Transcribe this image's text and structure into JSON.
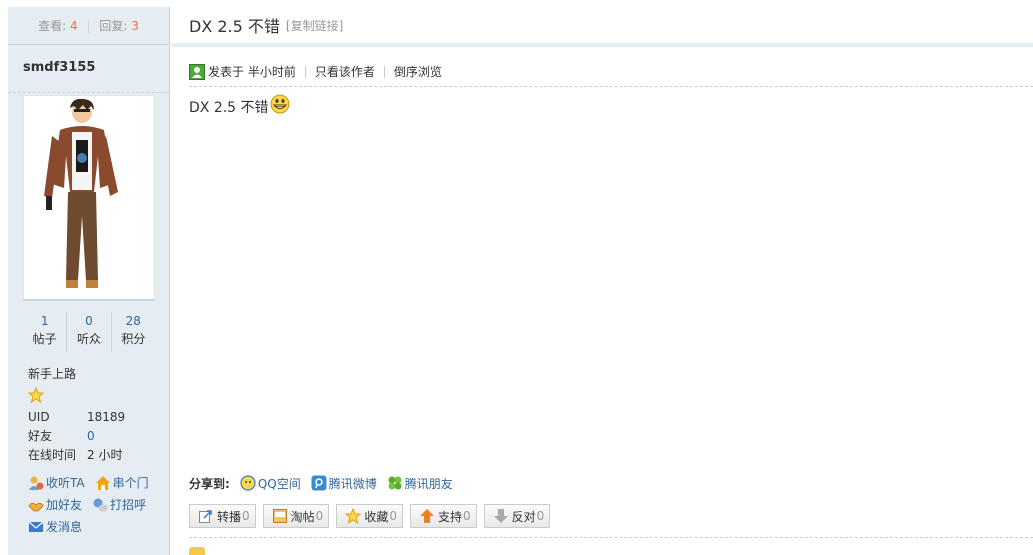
{
  "sidebar": {
    "stats": {
      "views_label": "查看:",
      "views": "4",
      "replies_label": "回复:",
      "replies": "3"
    },
    "author": "smdf3155",
    "counters": [
      {
        "value": "1",
        "label": "帖子"
      },
      {
        "value": "0",
        "label": "听众"
      },
      {
        "value": "28",
        "label": "积分"
      }
    ],
    "rank": "新手上路",
    "info": [
      {
        "key": "UID",
        "value": "18189"
      },
      {
        "key": "好友",
        "value": "0"
      },
      {
        "key": "在线时间",
        "value": "2 小时"
      }
    ],
    "actions": {
      "follow": "收听TA",
      "visit": "串个门",
      "add_friend": "加好友",
      "greet": "打招呼",
      "message": "发消息"
    }
  },
  "thread": {
    "title": "DX 2.5 不错",
    "copy_link": "[复制链接]",
    "meta": {
      "posted": "发表于 半小时前",
      "author_only": "只看该作者",
      "reverse": "倒序浏览"
    },
    "body": "DX 2.5 不错"
  },
  "share": {
    "label": "分享到:",
    "items": [
      "QQ空间",
      "腾讯微博",
      "腾讯朋友"
    ]
  },
  "buttons": [
    {
      "label": "转播",
      "count": "0"
    },
    {
      "label": "淘帖",
      "count": "0"
    },
    {
      "label": "收藏",
      "count": "0"
    },
    {
      "label": "支持",
      "count": "0"
    },
    {
      "label": "反对",
      "count": "0"
    }
  ],
  "colors": {
    "accent": "#336699",
    "count": "#f26c4f",
    "sidebar_bg": "#e5edf2",
    "border": "#c2d5e3"
  },
  "icons": [
    "user-icon",
    "star-icon",
    "follow-icon",
    "home-icon",
    "add-friend-icon",
    "greet-icon",
    "mail-icon",
    "emoji-grin-icon",
    "qzone-icon",
    "tencent-weibo-icon",
    "tencent-friends-icon",
    "forward-icon",
    "collection-icon",
    "favorite-icon",
    "thumbs-up-icon",
    "thumbs-down-icon"
  ]
}
